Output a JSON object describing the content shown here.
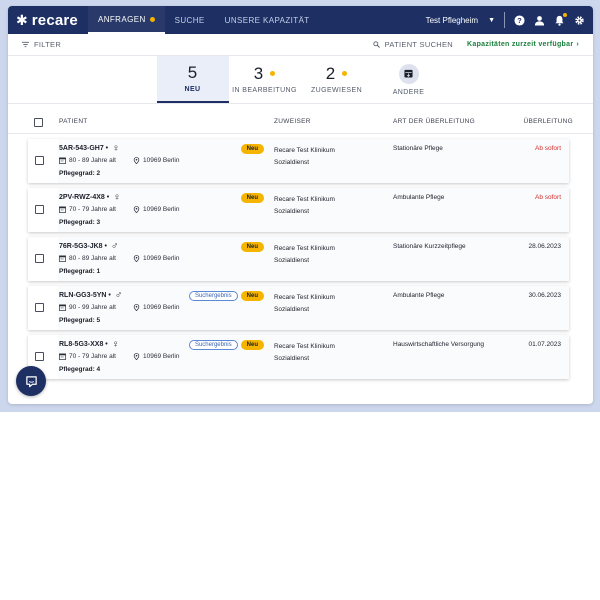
{
  "app": {
    "logo_text": "recare"
  },
  "nav": [
    {
      "label": "ANFRAGEN",
      "active": true,
      "dot": true
    },
    {
      "label": "SUCHE",
      "active": false,
      "dot": false
    },
    {
      "label": "UNSERE KAPAZITÄT",
      "active": false,
      "dot": false
    }
  ],
  "user": {
    "name": "Test Pflegheim"
  },
  "filterbar": {
    "filter_label": "FILTER",
    "search_label": "PATIENT SUCHEN",
    "capacity_label": "Kapazitäten zurzeit verfügbar"
  },
  "counters": [
    {
      "count": "5",
      "label": "NEU",
      "active": true,
      "dot": false
    },
    {
      "count": "3",
      "label": "IN BEARBEITUNG",
      "active": false,
      "dot": true
    },
    {
      "count": "2",
      "label": "ZUGEWIESEN",
      "active": false,
      "dot": true
    },
    {
      "count": "",
      "label": "ANDERE",
      "active": false,
      "dot": false
    }
  ],
  "table": {
    "headers": {
      "patient": "PATIENT",
      "zuweiser": "ZUWEISER",
      "art": "ART DER ÜBERLEITUNG",
      "ueberleitung": "ÜBERLEITUNG"
    },
    "rows": [
      {
        "id": "5AR-543-GH7 •",
        "gender": "♀",
        "age": "80 - 89 Jahre alt",
        "location": "10969 Berlin",
        "care": "Pflegegrad: 2",
        "badges": [
          "Neu"
        ],
        "zuweiser1": "Recare Test Klinikum",
        "zuweiser2": "Sozialdienst",
        "art": "Stationäre Pflege",
        "date": "Ab sofort",
        "urgent": true
      },
      {
        "id": "2PV-RWZ-4X8 •",
        "gender": "♀",
        "age": "70 - 79 Jahre alt",
        "location": "10969 Berlin",
        "care": "Pflegegrad: 3",
        "badges": [
          "Neu"
        ],
        "zuweiser1": "Recare Test Klinikum",
        "zuweiser2": "Sozialdienst",
        "art": "Ambulante Pflege",
        "date": "Ab sofort",
        "urgent": true
      },
      {
        "id": "76R-5G3-JK8 •",
        "gender": "♂",
        "age": "80 - 89 Jahre alt",
        "location": "10969 Berlin",
        "care": "Pflegegrad: 1",
        "badges": [
          "Neu"
        ],
        "zuweiser1": "Recare Test Klinikum",
        "zuweiser2": "Sozialdienst",
        "art": "Stationäre Kurzzeitpflege",
        "date": "28.06.2023",
        "urgent": false
      },
      {
        "id": "RLN-GG3-5YN •",
        "gender": "♂",
        "age": "90 - 99 Jahre alt",
        "location": "10969 Berlin",
        "care": "Pflegegrad: 5",
        "badges": [
          "Suchergebnis",
          "Neu"
        ],
        "zuweiser1": "Recare Test Klinikum",
        "zuweiser2": "Sozialdienst",
        "art": "Ambulante Pflege",
        "date": "30.06.2023",
        "urgent": false
      },
      {
        "id": "RL8-5G3-XX8 •",
        "gender": "♀",
        "age": "70 - 79 Jahre alt",
        "location": "10969 Berlin",
        "care": "Pflegegrad: 4",
        "badges": [
          "Suchergebnis",
          "Neu"
        ],
        "zuweiser1": "Recare Test Klinikum",
        "zuweiser2": "Sozialdienst",
        "art": "Hauswirtschaftliche Versorgung",
        "date": "01.07.2023",
        "urgent": false
      }
    ]
  },
  "colors": {
    "navy": "#1d2f63",
    "accent_dot": "#f5b400",
    "urgent_red": "#d32f2f",
    "capacity_green": "#1a7f3b"
  }
}
